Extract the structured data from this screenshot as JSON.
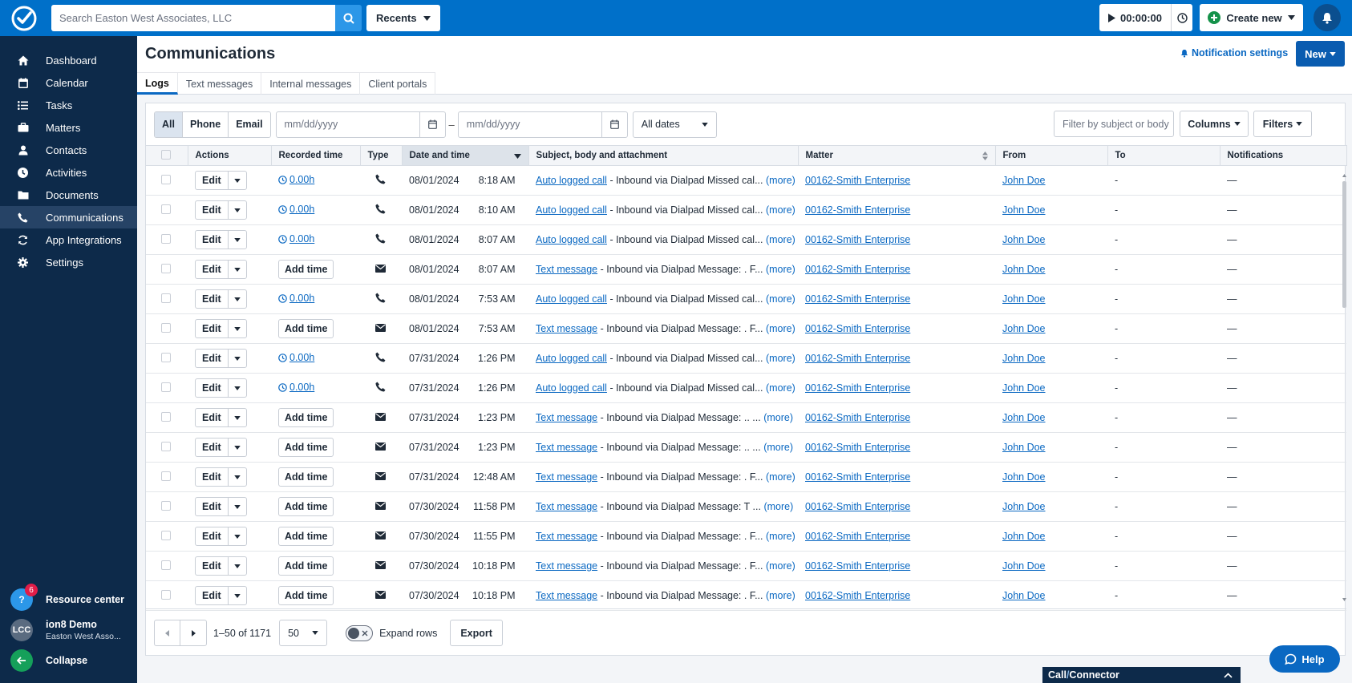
{
  "topbar": {
    "search_placeholder": "Search Easton West Associates, LLC",
    "recents_label": "Recents",
    "timer_value": "00:00:00",
    "create_new_label": "Create new"
  },
  "sidebar": {
    "items": [
      {
        "label": "Dashboard",
        "icon": "home-icon"
      },
      {
        "label": "Calendar",
        "icon": "calendar-icon"
      },
      {
        "label": "Tasks",
        "icon": "list-icon"
      },
      {
        "label": "Matters",
        "icon": "briefcase-icon"
      },
      {
        "label": "Contacts",
        "icon": "person-icon"
      },
      {
        "label": "Activities",
        "icon": "clock-icon"
      },
      {
        "label": "Documents",
        "icon": "folder-icon"
      },
      {
        "label": "Communications",
        "icon": "phone-icon",
        "active": true
      },
      {
        "label": "App Integrations",
        "icon": "sync-icon"
      },
      {
        "label": "Settings",
        "icon": "gear-icon"
      }
    ],
    "resource_center": {
      "label": "Resource center",
      "badge": "6"
    },
    "user": {
      "initials": "LCC",
      "name": "ion8 Demo",
      "firm": "Easton West Asso..."
    },
    "collapse_label": "Collapse"
  },
  "header": {
    "title": "Communications",
    "notification_settings": "Notification settings",
    "new_label": "New"
  },
  "tabs": [
    "Logs",
    "Text messages",
    "Internal messages",
    "Client portals"
  ],
  "filters": {
    "type_options": [
      "All",
      "Phone",
      "Email"
    ],
    "date_from_placeholder": "mm/dd/yyyy",
    "date_separator": "–",
    "date_to_placeholder": "mm/dd/yyyy",
    "date_range": "All dates",
    "filter_placeholder": "Filter by subject or body",
    "columns_label": "Columns",
    "filters_label": "Filters"
  },
  "table": {
    "columns": [
      "Actions",
      "Recorded time",
      "Type",
      "Date and time",
      "Subject, body and attachment",
      "Matter",
      "From",
      "To",
      "Notifications"
    ],
    "edit_label": "Edit",
    "add_time_label": "Add time",
    "more_label": "(more)",
    "rows": [
      {
        "rec": "0.00h",
        "type": "phone",
        "date": "08/01/2024",
        "time": "8:18 AM",
        "subj": "Auto logged call",
        "body": "- Inbound via Dialpad Missed cal...",
        "matter": "00162-Smith Enterprise",
        "from": "John Doe",
        "to": "-",
        "notif": "—"
      },
      {
        "rec": "0.00h",
        "type": "phone",
        "date": "08/01/2024",
        "time": "8:10 AM",
        "subj": "Auto logged call",
        "body": "- Inbound via Dialpad Missed cal...",
        "matter": "00162-Smith Enterprise",
        "from": "John Doe",
        "to": "-",
        "notif": "—"
      },
      {
        "rec": "0.00h",
        "type": "phone",
        "date": "08/01/2024",
        "time": "8:07 AM",
        "subj": "Auto logged call",
        "body": "- Inbound via Dialpad Missed cal...",
        "matter": "00162-Smith Enterprise",
        "from": "John Doe",
        "to": "-",
        "notif": "—"
      },
      {
        "rec": "",
        "type": "email",
        "date": "08/01/2024",
        "time": "8:07 AM",
        "subj": "Text message",
        "body": "- Inbound via Dialpad Message: . F...",
        "matter": "00162-Smith Enterprise",
        "from": "John Doe",
        "to": "-",
        "notif": "—"
      },
      {
        "rec": "0.00h",
        "type": "phone",
        "date": "08/01/2024",
        "time": "7:53 AM",
        "subj": "Auto logged call",
        "body": "- Inbound via Dialpad Missed cal...",
        "matter": "00162-Smith Enterprise",
        "from": "John Doe",
        "to": "-",
        "notif": "—"
      },
      {
        "rec": "",
        "type": "email",
        "date": "08/01/2024",
        "time": "7:53 AM",
        "subj": "Text message",
        "body": "- Inbound via Dialpad Message: . F...",
        "matter": "00162-Smith Enterprise",
        "from": "John Doe",
        "to": "-",
        "notif": "—"
      },
      {
        "rec": "0.00h",
        "type": "phone",
        "date": "07/31/2024",
        "time": "1:26 PM",
        "subj": "Auto logged call",
        "body": "- Inbound via Dialpad Missed cal...",
        "matter": "00162-Smith Enterprise",
        "from": "John Doe",
        "to": "-",
        "notif": "—"
      },
      {
        "rec": "0.00h",
        "type": "phone",
        "date": "07/31/2024",
        "time": "1:26 PM",
        "subj": "Auto logged call",
        "body": "- Inbound via Dialpad Missed cal...",
        "matter": "00162-Smith Enterprise",
        "from": "John Doe",
        "to": "-",
        "notif": "—"
      },
      {
        "rec": "",
        "type": "email",
        "date": "07/31/2024",
        "time": "1:23 PM",
        "subj": "Text message",
        "body": "- Inbound via Dialpad Message: .. ...",
        "matter": "00162-Smith Enterprise",
        "from": "John Doe",
        "to": "-",
        "notif": "—"
      },
      {
        "rec": "",
        "type": "email",
        "date": "07/31/2024",
        "time": "1:23 PM",
        "subj": "Text message",
        "body": "- Inbound via Dialpad Message: .. ...",
        "matter": "00162-Smith Enterprise",
        "from": "John Doe",
        "to": "-",
        "notif": "—"
      },
      {
        "rec": "",
        "type": "email",
        "date": "07/31/2024",
        "time": "12:48 AM",
        "subj": "Text message",
        "body": "- Inbound via Dialpad Message: . F...",
        "matter": "00162-Smith Enterprise",
        "from": "John Doe",
        "to": "-",
        "notif": "—"
      },
      {
        "rec": "",
        "type": "email",
        "date": "07/30/2024",
        "time": "11:58 PM",
        "subj": "Text message",
        "body": "- Inbound via Dialpad Message: T ...",
        "matter": "00162-Smith Enterprise",
        "from": "John Doe",
        "to": "-",
        "notif": "—"
      },
      {
        "rec": "",
        "type": "email",
        "date": "07/30/2024",
        "time": "11:55 PM",
        "subj": "Text message",
        "body": "- Inbound via Dialpad Message: . F...",
        "matter": "00162-Smith Enterprise",
        "from": "John Doe",
        "to": "-",
        "notif": "—"
      },
      {
        "rec": "",
        "type": "email",
        "date": "07/30/2024",
        "time": "10:18 PM",
        "subj": "Text message",
        "body": "- Inbound via Dialpad Message: . F...",
        "matter": "00162-Smith Enterprise",
        "from": "John Doe",
        "to": "-",
        "notif": "—"
      },
      {
        "rec": "",
        "type": "email",
        "date": "07/30/2024",
        "time": "10:18 PM",
        "subj": "Text message",
        "body": "- Inbound via Dialpad Message: . F...",
        "matter": "00162-Smith Enterprise",
        "from": "John Doe",
        "to": "-",
        "notif": "—"
      }
    ]
  },
  "footer": {
    "page_info": "1–50 of 1171",
    "per_page": "50",
    "expand_rows_label": "Expand rows",
    "export_label": "Export"
  },
  "call_connector": {
    "part1": "Call",
    "sep": "/",
    "part2": "Connector"
  },
  "help_label": "Help",
  "colors": {
    "brand": "#0070c9",
    "sidebar": "#0d2a4a",
    "link": "#0a68c2"
  }
}
